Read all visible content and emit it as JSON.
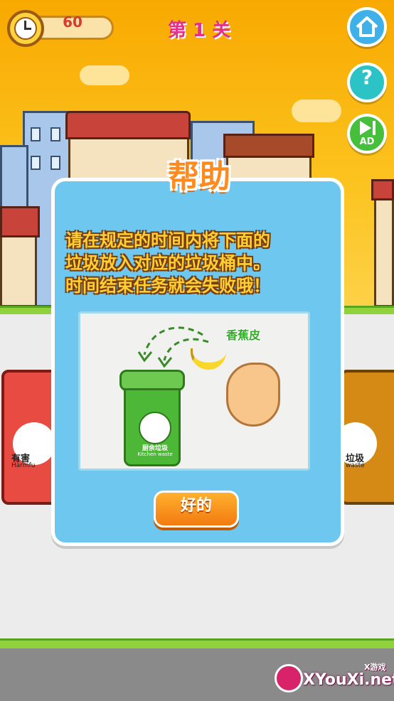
{
  "hud": {
    "timer_value": "60",
    "level_title": "第 1 关",
    "home_icon": "home-icon",
    "help_icon": "help-icon",
    "help_glyph": "?",
    "ad_icon": "play-video-ad-icon",
    "ad_label": "AD"
  },
  "dialog": {
    "title": "帮助",
    "instructions": [
      "请在规定的时间内将下面的",
      "垃圾放入对应的垃圾桶中。",
      "时间结束任务就会失败哦！"
    ],
    "illustration": {
      "item_label": "香蕉皮",
      "bin_label_cn": "厨余垃圾",
      "bin_label_en": "Kitchen waste"
    },
    "ok_label": "好的"
  },
  "background_bins": {
    "left_label_cn": "有害",
    "left_label_en": "Harmfu",
    "right_label_cn": "垃圾",
    "right_label_en": "waste"
  },
  "watermark": {
    "site": "XYouXi.net",
    "small": "X游戏"
  },
  "colors": {
    "sky": "#f8a900",
    "dialog_bg": "#6ec7ee",
    "title_orange": "#ff8a1e",
    "text_yellow": "#ffcf33",
    "level_pink": "#e0328a",
    "kitchen_bin_green": "#4db737"
  }
}
